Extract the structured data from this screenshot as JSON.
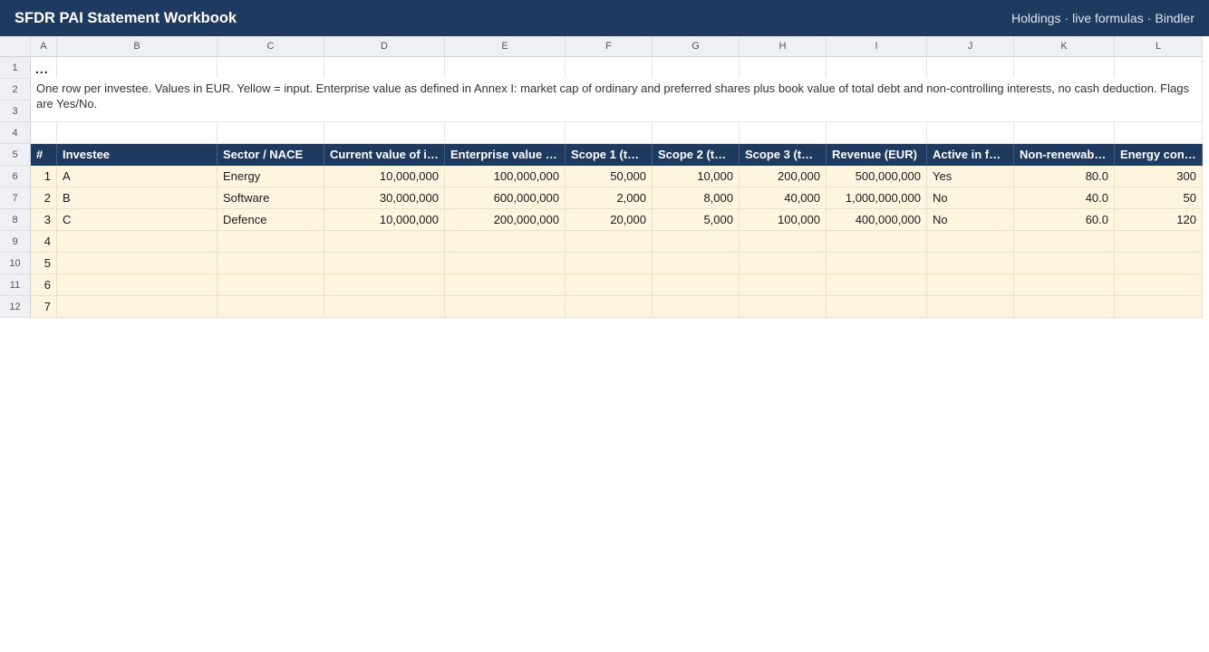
{
  "app": {
    "title": "SFDR PAI Statement Workbook",
    "right_items": [
      "Holdings",
      "live formulas",
      "Bindler"
    ],
    "separator": "·"
  },
  "columns": [
    "A",
    "B",
    "C",
    "D",
    "E",
    "F",
    "G",
    "H",
    "I",
    "J",
    "K",
    "L"
  ],
  "rows": [
    "1",
    "2",
    "3",
    "4",
    "5",
    "6",
    "7",
    "8",
    "9",
    "10",
    "11",
    "12"
  ],
  "row1_text": "...",
  "description": "One row per investee. Values in EUR. Yellow = input. Enterprise value as defined in Annex I: market cap of ordinary and preferred shares plus book value of total debt and non-controlling interests, no cash deduction. Flags are Yes/No.",
  "table": {
    "headers": [
      "#",
      "Investee",
      "Sector / NACE",
      "Current value of i…",
      "Enterprise value E…",
      "Scope 1 (tC…",
      "Scope 2 (tC…",
      "Scope 3 (tC…",
      "Revenue (EUR)",
      "Active in fo…",
      "Non-renewabl…",
      "Energy con…"
    ],
    "rows": [
      [
        "1",
        "A",
        "Energy",
        "10,000,000",
        "100,000,000",
        "50,000",
        "10,000",
        "200,000",
        "500,000,000",
        "Yes",
        "80.0",
        "300"
      ],
      [
        "2",
        "B",
        "Software",
        "30,000,000",
        "600,000,000",
        "2,000",
        "8,000",
        "40,000",
        "1,000,000,000",
        "No",
        "40.0",
        "50"
      ],
      [
        "3",
        "C",
        "Defence",
        "10,000,000",
        "200,000,000",
        "20,000",
        "5,000",
        "100,000",
        "400,000,000",
        "No",
        "60.0",
        "120"
      ],
      [
        "4",
        "",
        "",
        "",
        "",
        "",
        "",
        "",
        "",
        "",
        "",
        ""
      ],
      [
        "5",
        "",
        "",
        "",
        "",
        "",
        "",
        "",
        "",
        "",
        "",
        ""
      ],
      [
        "6",
        "",
        "",
        "",
        "",
        "",
        "",
        "",
        "",
        "",
        "",
        ""
      ],
      [
        "7",
        "",
        "",
        "",
        "",
        "",
        "",
        "",
        "",
        "",
        "",
        ""
      ]
    ]
  },
  "colors": {
    "header_bg": "#1f3a5f",
    "input_bg": "#fdf5e0",
    "gridline": "#e3e6ea"
  }
}
